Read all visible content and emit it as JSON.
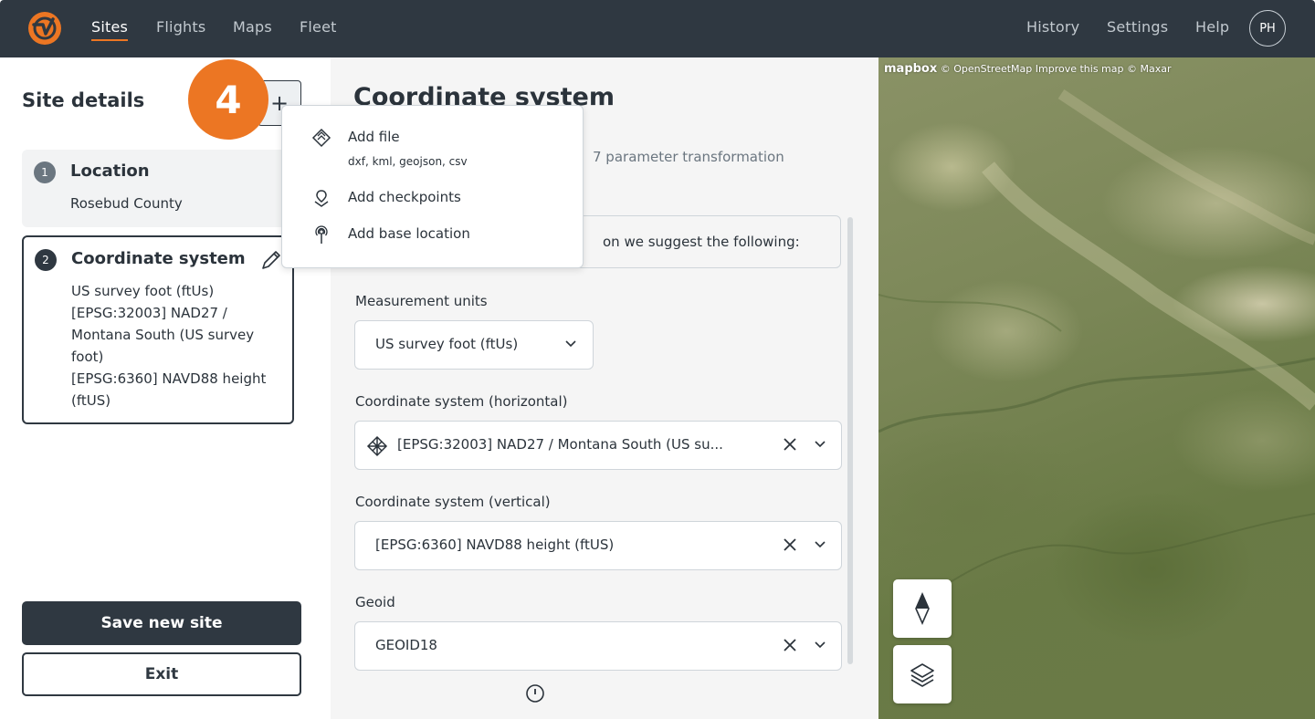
{
  "nav": {
    "left": [
      "Sites",
      "Flights",
      "Maps",
      "Fleet"
    ],
    "right": [
      "History",
      "Settings",
      "Help"
    ],
    "avatar": "PH"
  },
  "sidebar": {
    "title": "Site details",
    "steps": [
      {
        "num": "1",
        "title": "Location",
        "subtitle": "Rosebud County"
      },
      {
        "num": "2",
        "title": "Coordinate system",
        "lines": [
          "US survey foot (ftUs)",
          "[EPSG:32003] NAD27 /",
          "Montana South (US survey",
          "foot)",
          "[EPSG:6360] NAVD88 height",
          "(ftUS)"
        ]
      }
    ],
    "save_label": "Save new site",
    "exit_label": "Exit"
  },
  "badge": "4",
  "dropdown": {
    "items": [
      {
        "label": "Add file",
        "sub": "dxf, kml, geojson, csv",
        "icon": "add-file-icon"
      },
      {
        "label": "Add checkpoints",
        "icon": "checkpoint-icon"
      },
      {
        "label": "Add base location",
        "icon": "base-location-icon"
      }
    ]
  },
  "main": {
    "title": "Coordinate system",
    "param_text": "7 parameter transformation",
    "suggest_text": "on we suggest the following:",
    "fields": [
      {
        "label": "Measurement units",
        "value": "US survey foot (ftUs)"
      },
      {
        "label": "Coordinate system (horizontal)",
        "value": "[EPSG:32003] NAD27 / Montana South (US su..."
      },
      {
        "label": "Coordinate system (vertical)",
        "value": "[EPSG:6360] NAVD88 height (ftUS)"
      },
      {
        "label": "Geoid",
        "value": "GEOID18"
      }
    ]
  },
  "map": {
    "brand": "mapbox",
    "attribution": "© OpenStreetMap  Improve this map  © Maxar"
  },
  "colors": {
    "accent": "#ec7623",
    "topbar": "#2f3841"
  }
}
